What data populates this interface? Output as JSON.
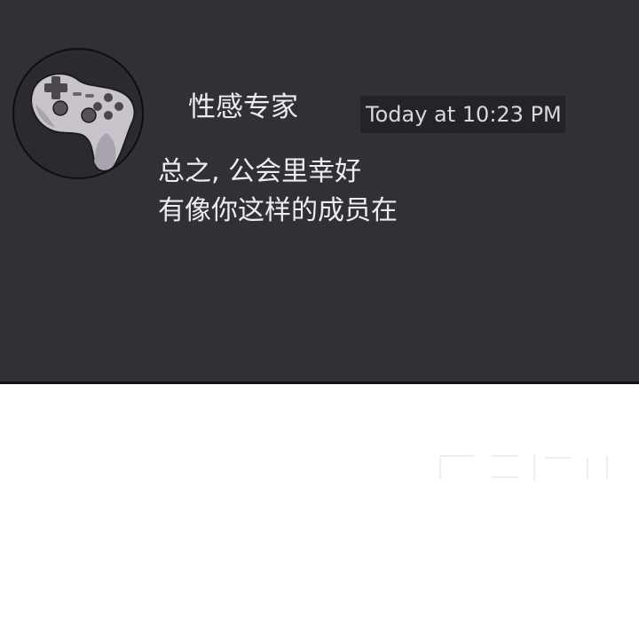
{
  "chat": {
    "username": "性感专家",
    "timestamp": "Today at 10:23 PM",
    "message_lines": [
      "总之, 公会里幸好",
      "有像你这样的成员在"
    ]
  },
  "avatar": {
    "icon": "gamepad-icon"
  },
  "colors": {
    "panel_background": "#313036",
    "timestamp_background": "#242328",
    "page_background": "#ffffff",
    "text": "#ececee"
  }
}
